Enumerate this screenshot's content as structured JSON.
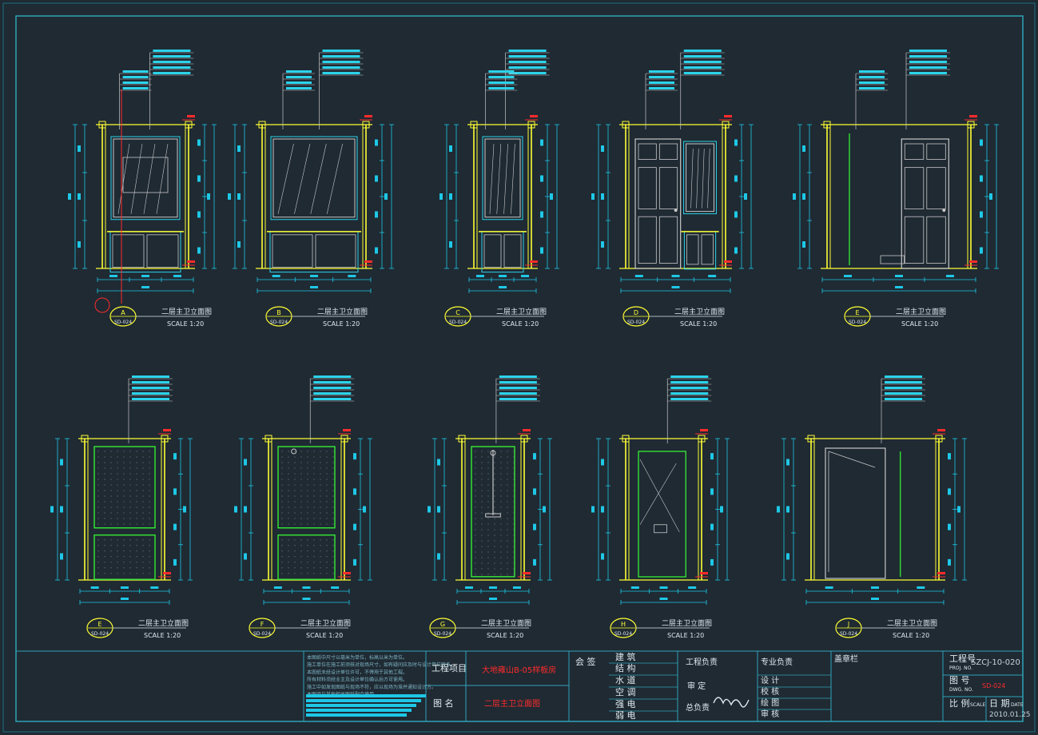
{
  "colors": {
    "background": "#1f2a33",
    "frame": "#2fa3b8",
    "wall": "#ffff33",
    "cabinet": "#2bd3ea",
    "dimension": "#1ec8e6",
    "tile": "#33e033",
    "fixture": "#c8c8c8",
    "red_note": "#ff2b2b",
    "title_text": "#dfe9ee"
  },
  "elevations": [
    {
      "mark": "A",
      "sheet": "SD-024",
      "title": "二层主卫立面图",
      "scale": "SCALE  1:20",
      "kind": "vanity-small"
    },
    {
      "mark": "B",
      "sheet": "SD-024",
      "title": "二层主卫立面图",
      "scale": "SCALE  1:20",
      "kind": "vanity-wide"
    },
    {
      "mark": "C",
      "sheet": "SD-024",
      "title": "二层主卫立面图",
      "scale": "SCALE  1:20",
      "kind": "vanity-small"
    },
    {
      "mark": "D",
      "sheet": "SD-024",
      "title": "二层主卫立面图",
      "scale": "SCALE  1:20",
      "kind": "door-vanity"
    },
    {
      "mark": "E",
      "sheet": "SD-024",
      "title": "二层主卫立面图",
      "scale": "SCALE  1:20",
      "kind": "door-wide"
    },
    {
      "mark": "E",
      "sheet": "SD-024",
      "title": "二层主卫立面图",
      "scale": "SCALE  1:20",
      "kind": "tile-panel"
    },
    {
      "mark": "F",
      "sheet": "SD-024",
      "title": "二层主卫立面图",
      "scale": "SCALE  1:20",
      "kind": "tile-shower"
    },
    {
      "mark": "G",
      "sheet": "SD-024",
      "title": "二层主卫立面图",
      "scale": "SCALE  1:20",
      "kind": "shower-narrow"
    },
    {
      "mark": "H",
      "sheet": "SD-024",
      "title": "二层主卫立面图",
      "scale": "SCALE  1:20",
      "kind": "glass-shower"
    },
    {
      "mark": "J",
      "sheet": "SD-024",
      "title": "二层主卫立面图",
      "scale": "SCALE  1:20",
      "kind": "opening"
    }
  ],
  "title_block": {
    "project_label": "工程项目",
    "project_value": "大地雍山B-05样板房",
    "drawing_label": "图    名",
    "drawing_value": "二层主卫立面图",
    "sign_label": "会   签",
    "disciplines": [
      "建  筑",
      "结  构",
      "水  道",
      "空  调",
      "强  电",
      "弱  电"
    ],
    "project_lead": "工程负责",
    "review": "审  定",
    "chief": "总负责",
    "specialty_lead": "专业负责",
    "roles": [
      "设  计",
      "校  核",
      "绘  图",
      "审  核"
    ],
    "stamp_label": "盖章栏",
    "project_no_label": "工程号",
    "project_no_sub": "PROJ. NO.",
    "project_no": "SZCJ-10-020",
    "drawing_no_label": "图  号",
    "drawing_no_sub": "DWG. NO.",
    "drawing_no": "SD-024",
    "scale_label": "比  例",
    "scale_sub": "SCALE",
    "date_label": "日  期",
    "date_sub": "DATE",
    "date": "2010.01.25",
    "notes": [
      "本图纸中尺寸以毫米为单位，标高以米为单位。",
      "施工单位在施工前须核对现场尺寸，如有疑问应及时与设计单位联系。",
      "本图纸未经设计单位许可，不得用于其他工程。",
      "所有材料须经业主及设计单位确认后方可使用。",
      "施工中如发现图纸与现场不符，应以现场为准并通知设计方。",
      "本图须与其他相关图纸配合使用。"
    ]
  }
}
